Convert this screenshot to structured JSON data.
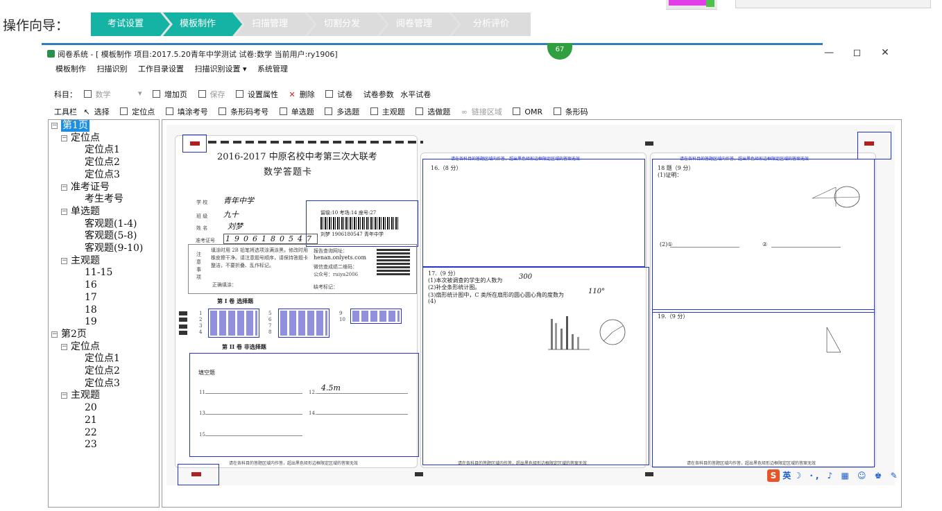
{
  "wizard": {
    "title": "操作向导：",
    "steps": [
      {
        "label": "考试设置",
        "active": true
      },
      {
        "label": "模板制作",
        "active": true
      },
      {
        "label": "扫描管理",
        "active": false
      },
      {
        "label": "切割分发",
        "active": false
      },
      {
        "label": "阅卷管理",
        "active": false
      },
      {
        "label": "分析评价",
        "active": false
      }
    ],
    "badge": "67"
  },
  "window": {
    "title": "阅卷系统 - [ 模板制作 项目:2017.5.20青年中学测试  试卷:数学  当前用户:ry1906]",
    "controls": {
      "minimize": "—",
      "maximize": "◻",
      "close": "✕"
    }
  },
  "menu": [
    "模板制作",
    "扫描识别",
    "工作目录设置",
    "扫描识别设置 ▾",
    "系统管理"
  ],
  "toolbar1": {
    "subject_label": "科目：",
    "subject_value": "数学",
    "items": [
      "增加页",
      "保存",
      "设置属性",
      "删除",
      "试卷",
      "试卷参数",
      "水平试卷"
    ]
  },
  "toolbar2": {
    "label": "工具栏",
    "items": [
      "选择",
      "定位点",
      "填涂考号",
      "条形码考号",
      "单选题",
      "多选题",
      "主观题",
      "选做题",
      "链接区域",
      "OMR",
      "条形码"
    ]
  },
  "tree": [
    {
      "label": "第1页",
      "level": 0,
      "selected": true,
      "expander": "⊟"
    },
    {
      "label": "定位点",
      "level": 1,
      "expander": "⊟"
    },
    {
      "label": "定位点1",
      "level": 2
    },
    {
      "label": "定位点2",
      "level": 2
    },
    {
      "label": "定位点3",
      "level": 2
    },
    {
      "label": "准考证号",
      "level": 1,
      "expander": "⊟"
    },
    {
      "label": "考生考号",
      "level": 2
    },
    {
      "label": "单选题",
      "level": 1,
      "expander": "⊟"
    },
    {
      "label": "客观题(1-4)",
      "level": 2
    },
    {
      "label": "客观题(5-8)",
      "level": 2
    },
    {
      "label": "客观题(9-10)",
      "level": 2
    },
    {
      "label": "主观题",
      "level": 1,
      "expander": "⊟"
    },
    {
      "label": "11-15",
      "level": 2
    },
    {
      "label": "16",
      "level": 2
    },
    {
      "label": "17",
      "level": 2
    },
    {
      "label": "18",
      "level": 2
    },
    {
      "label": "19",
      "level": 2
    },
    {
      "label": "第2页",
      "level": 0,
      "expander": "⊟"
    },
    {
      "label": "定位点",
      "level": 1,
      "expander": "⊟"
    },
    {
      "label": "定位点1",
      "level": 2
    },
    {
      "label": "定位点2",
      "level": 2
    },
    {
      "label": "定位点3",
      "level": 2
    },
    {
      "label": "主观题",
      "level": 1,
      "expander": "⊟"
    },
    {
      "label": "20",
      "level": 2
    },
    {
      "label": "21",
      "level": 2
    },
    {
      "label": "22",
      "level": 2
    },
    {
      "label": "23",
      "level": 2
    }
  ],
  "sheet": {
    "title": "2016-2017 中原名校中考第三次大联考",
    "subtitle": "数学答题卡",
    "school_label": "学  校",
    "school_value": "青年中学",
    "class_label": "班  级",
    "class_value": "九十",
    "name_label": "姓  名",
    "name_value": "刘梦",
    "ticket_label": "准考证号",
    "ticket_value": "1906180547",
    "barcode_line1": "留级:10  考场:14  座号:27",
    "barcode_line2": "刘梦    1906180547  青年中学",
    "notice_label": "注意事项",
    "notice_text": "填涂时用 2B 铅笔将选项涂满涂黑，修改时用橡皮擦干净。请注意题号顺序，请保持答题卡整洁，不要折叠、乱作标记。",
    "correct_fill": "正确填涂：",
    "report_line1": "报告查询网址：",
    "report_site": "henan.onlyets.com",
    "report_line3": "微信查成绩二维码：",
    "report_line4": "公众号：ruiya2006",
    "absent_mark": "缺考标记：",
    "section1": "第 I 卷  选择题",
    "section2": "第 II 卷  非选择题",
    "fill_blank": "填空题",
    "handwritten_answer": "4.5m",
    "q16": "16.（8 分）",
    "q17": "17.（9 分）",
    "q17_lines": [
      "(1)本次被调查的学生的人数为",
      "(2)补全条形统计图。",
      "(3)扇形统计图中，C 类所在扇形的圆心圆心角的度数为",
      "(4)"
    ],
    "q17_ans1": "300",
    "q17_ans3": "110°",
    "q18": "18 题（9 分）",
    "q18_sub1": "(1)证明：",
    "q18_sub2": "(2)①",
    "q18_sub3": "②",
    "q19": "19.（9 分）",
    "header_note": "请在各科目的答题区域内作答，超出黑色矩形边框限定区域的答案无效",
    "footer_note": "请在各科目的答题区域内作答，超出黑色矩形边框限定区域的答案无效",
    "choice_numbers_a": [
      "1",
      "2",
      "3",
      "4"
    ],
    "choice_numbers_b": [
      "5",
      "6",
      "7",
      "8"
    ],
    "choice_numbers_c": [
      "9",
      "10"
    ],
    "blank_numbers": [
      "11.",
      "12.",
      "13.",
      "14.",
      "15."
    ]
  },
  "ime": {
    "label": "英",
    "logo": "S"
  },
  "colors": {
    "accent": "#14b3a3",
    "selection": "#1e8fe0",
    "bbox": "#2233cc",
    "marker": "#b02020"
  }
}
